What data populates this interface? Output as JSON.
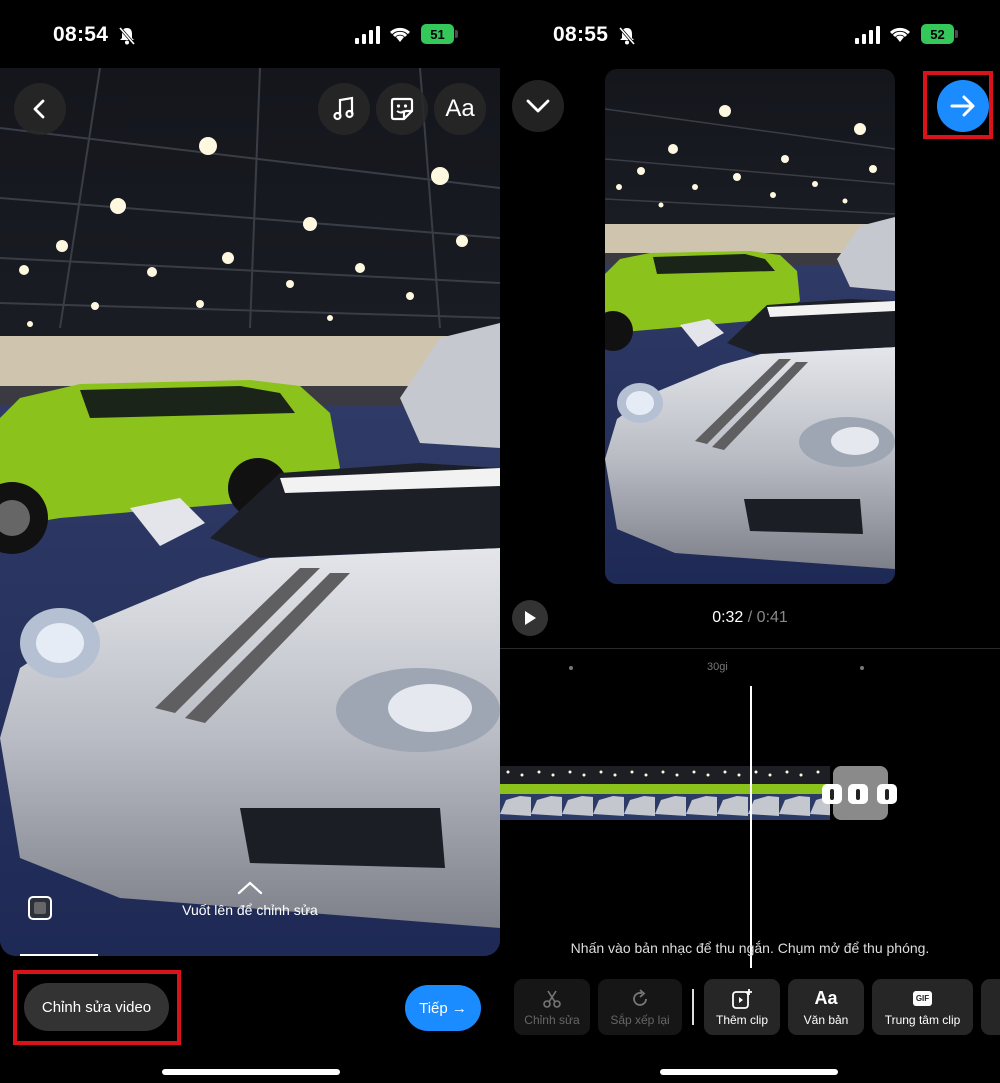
{
  "left": {
    "status": {
      "time": "08:54",
      "battery": "51"
    },
    "toolbar_icons": {
      "back": "chevron-left-icon",
      "music": "music-note-icon",
      "sticker": "sticker-icon",
      "text": "Aa"
    },
    "swipe_hint": "Vuốt lên để chỉnh sửa",
    "edit_video_label": "Chỉnh sửa video",
    "next_label": "Tiếp →"
  },
  "right": {
    "status": {
      "time": "08:55",
      "battery": "52"
    },
    "timecode": {
      "current": "0:32",
      "separator": " / ",
      "total": "0:41"
    },
    "ruler_label": "30gi",
    "hint": "Nhấn vào bản nhạc để thu ngắn. Chụm mở để thu phóng.",
    "tools": [
      {
        "label": "Chỉnh sửa",
        "icon": "scissors-icon",
        "enabled": false
      },
      {
        "label": "Sắp xếp lại",
        "icon": "rotate-icon",
        "enabled": false
      },
      {
        "label": "Thêm clip",
        "icon": "add-clip-icon",
        "enabled": true
      },
      {
        "label": "Văn bản",
        "icon": "text-icon",
        "enabled": true
      },
      {
        "label": "Trung tâm clip",
        "icon": "gif-icon",
        "enabled": true
      }
    ]
  },
  "colors": {
    "accent": "#1a8cff",
    "highlight_border": "#d8141a",
    "battery": "#34c759"
  }
}
